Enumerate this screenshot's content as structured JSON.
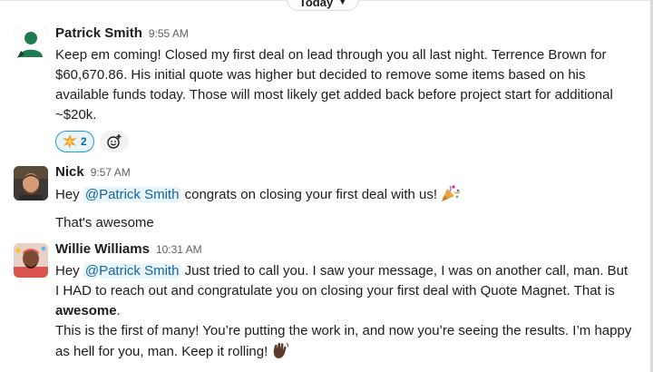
{
  "date_divider": {
    "label": "Today"
  },
  "messages": [
    {
      "author": "Patrick Smith",
      "time": "9:55 AM",
      "text": "Keep em coming! Closed my first deal on lead through you all last night. Terrence Brown for $60,670.86. His initial quote was higher but decided to remove some items based on his available funds today. Those will most likely get added back before project start for additional ~$20k.",
      "reactions": [
        {
          "emoji": "collision",
          "count": "2"
        }
      ]
    },
    {
      "author": "Nick",
      "time": "9:57 AM",
      "mention": "@Patrick Smith",
      "text": " congrats on closing your first deal with us! ",
      "prefix": "Hey ",
      "emoji": "party-popper",
      "followup": "That's awesome"
    },
    {
      "author": "Willie Williams",
      "time": "10:31 AM",
      "prefix": "Hey ",
      "mention": "@Patrick Smith",
      "text": " Just tried to call you. I saw your message, I was on another call, man. But I HAD to reach out and congratulate you on closing your first deal with Quote Magnet. That is",
      "bold_word": "awesome",
      "bold_suffix": ".",
      "text2": "This is the first of many! You’re putting the work in, and now you’re seeing the results. I’m happy as hell for you, man. Keep it rolling! ",
      "emoji": "waving-hand"
    }
  ]
}
